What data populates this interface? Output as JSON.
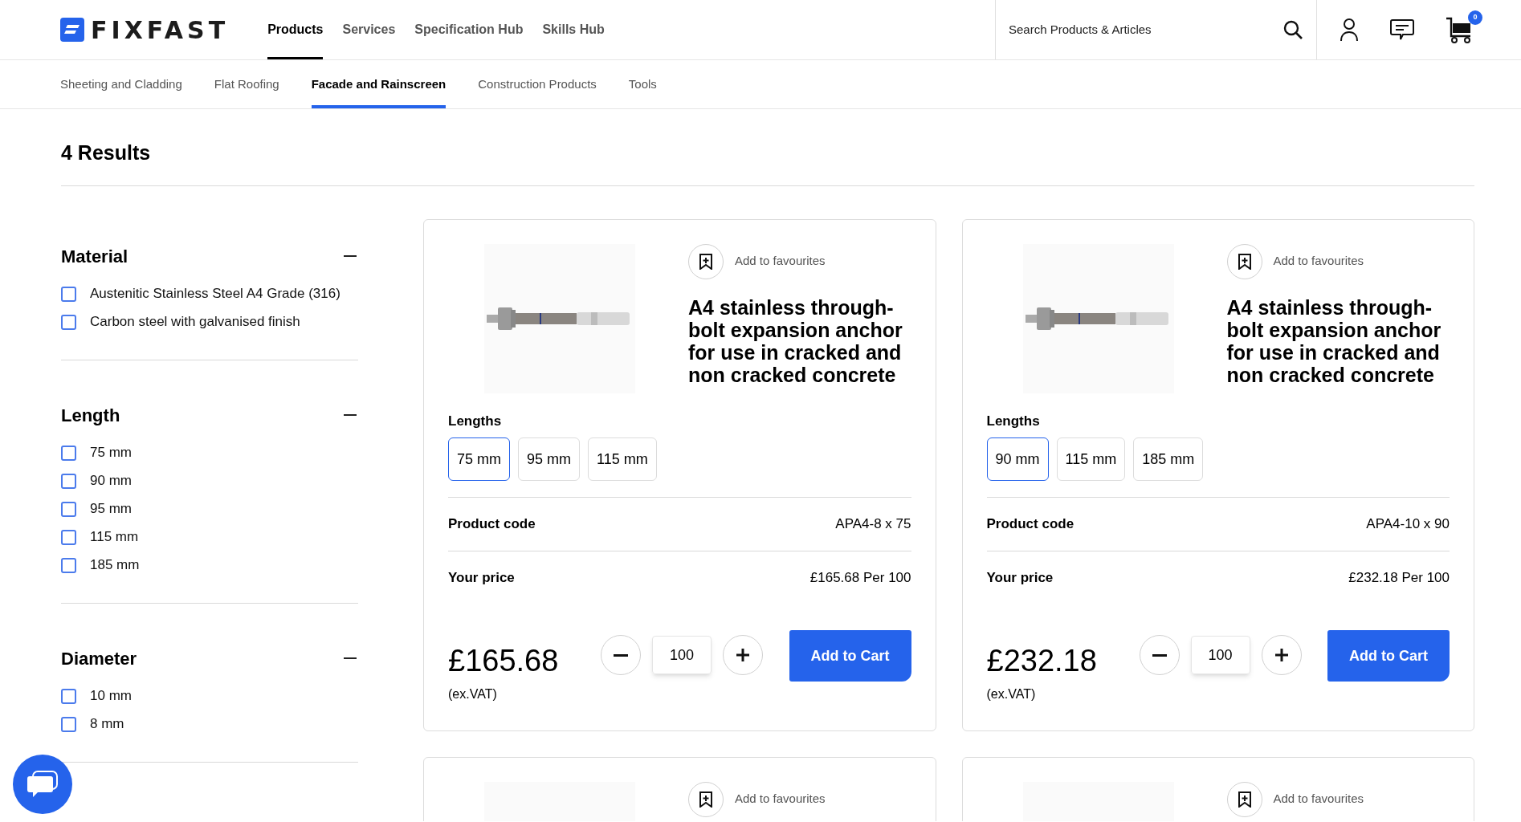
{
  "header": {
    "logo": "FIXFAST",
    "nav": [
      {
        "label": "Products",
        "selected": true
      },
      {
        "label": "Services",
        "selected": false
      },
      {
        "label": "Specification Hub",
        "selected": false
      },
      {
        "label": "Skills Hub",
        "selected": false
      }
    ],
    "search": {
      "placeholder": "Search Products & Articles"
    },
    "cart_count": "0"
  },
  "categories": [
    {
      "label": "Sheeting and Cladding",
      "selected": false
    },
    {
      "label": "Flat Roofing",
      "selected": false
    },
    {
      "label": "Facade and Rainscreen",
      "selected": true
    },
    {
      "label": "Construction Products",
      "selected": false
    },
    {
      "label": "Tools",
      "selected": false
    }
  ],
  "results_title": "4 Results",
  "filters": [
    {
      "title": "Material",
      "expanded": true,
      "options": [
        {
          "label": "Austenitic Stainless Steel A4 Grade (316)",
          "checked": false
        },
        {
          "label": "Carbon steel with galvanised finish",
          "checked": false
        }
      ]
    },
    {
      "title": "Length",
      "expanded": true,
      "options": [
        {
          "label": "75 mm",
          "checked": false
        },
        {
          "label": "90 mm",
          "checked": false
        },
        {
          "label": "95 mm",
          "checked": false
        },
        {
          "label": "115 mm",
          "checked": false
        },
        {
          "label": "185 mm",
          "checked": false
        }
      ]
    },
    {
      "title": "Diameter",
      "expanded": true,
      "options": [
        {
          "label": "10 mm",
          "checked": false
        },
        {
          "label": "8 mm",
          "checked": false
        }
      ]
    }
  ],
  "products": [
    {
      "favourite_label": "Add to favourites",
      "title": "A4 stainless through-bolt expansion anchor for use in cracked and non cracked concrete",
      "lengths_label": "Lengths",
      "lengths": [
        {
          "label": "75 mm",
          "selected": true
        },
        {
          "label": "95 mm",
          "selected": false
        },
        {
          "label": "115 mm",
          "selected": false
        }
      ],
      "code_label": "Product code",
      "code": "APA4-8 x 75",
      "price_label": "Your price",
      "price_per": "£165.68 Per 100",
      "price": "£165.68",
      "vat_note": "(ex.VAT)",
      "quantity": "100",
      "add_to_cart": "Add to Cart"
    },
    {
      "favourite_label": "Add to favourites",
      "title": "A4 stainless through-bolt expansion anchor for use in cracked and non cracked concrete",
      "lengths_label": "Lengths",
      "lengths": [
        {
          "label": "90 mm",
          "selected": true
        },
        {
          "label": "115 mm",
          "selected": false
        },
        {
          "label": "185 mm",
          "selected": false
        }
      ],
      "code_label": "Product code",
      "code": "APA4-10 x 90",
      "price_label": "Your price",
      "price_per": "£232.18 Per 100",
      "price": "£232.18",
      "vat_note": "(ex.VAT)",
      "quantity": "100",
      "add_to_cart": "Add to Cart"
    },
    {
      "favourite_label": "Add to favourites"
    },
    {
      "favourite_label": "Add to favourites"
    }
  ]
}
